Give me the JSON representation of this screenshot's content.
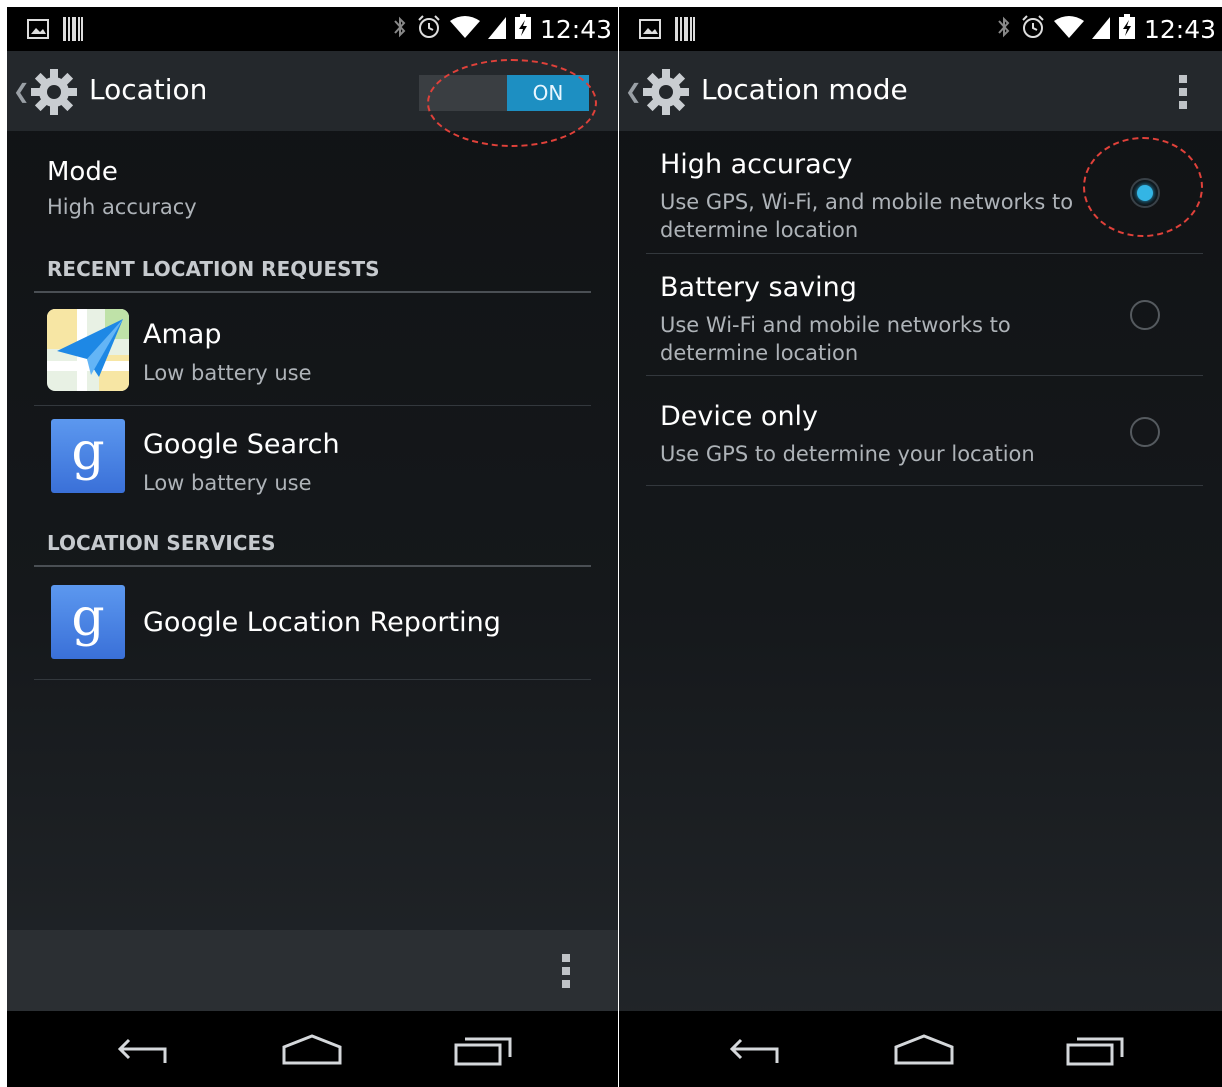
{
  "left": {
    "status": {
      "time": "12:43"
    },
    "actionbar": {
      "title": "Location",
      "toggle_label": "ON"
    },
    "mode": {
      "title": "Mode",
      "summary": "High accuracy"
    },
    "recent": {
      "header": "RECENT LOCATION REQUESTS",
      "items": [
        {
          "name": "Amap",
          "sub": "Low battery use",
          "icon": "amap-icon"
        },
        {
          "name": "Google Search",
          "sub": "Low battery use",
          "icon": "google-search-icon"
        }
      ]
    },
    "services": {
      "header": "LOCATION SERVICES",
      "items": [
        {
          "name": "Google Location Reporting",
          "icon": "google-icon"
        }
      ]
    },
    "google_letter": "g"
  },
  "right": {
    "status": {
      "time": "12:43"
    },
    "actionbar": {
      "title": "Location mode"
    },
    "options": [
      {
        "title": "High accuracy",
        "desc": "Use GPS, Wi-Fi, and mobile networks to determine location",
        "selected": true
      },
      {
        "title": "Battery saving",
        "desc": "Use Wi-Fi and mobile networks to determine location",
        "selected": false
      },
      {
        "title": "Device only",
        "desc": "Use GPS to determine your location",
        "selected": false
      }
    ]
  },
  "colors": {
    "accent": "#33b5e5",
    "toggle_on": "#1d8fc2",
    "annotation": "#e0413a"
  }
}
